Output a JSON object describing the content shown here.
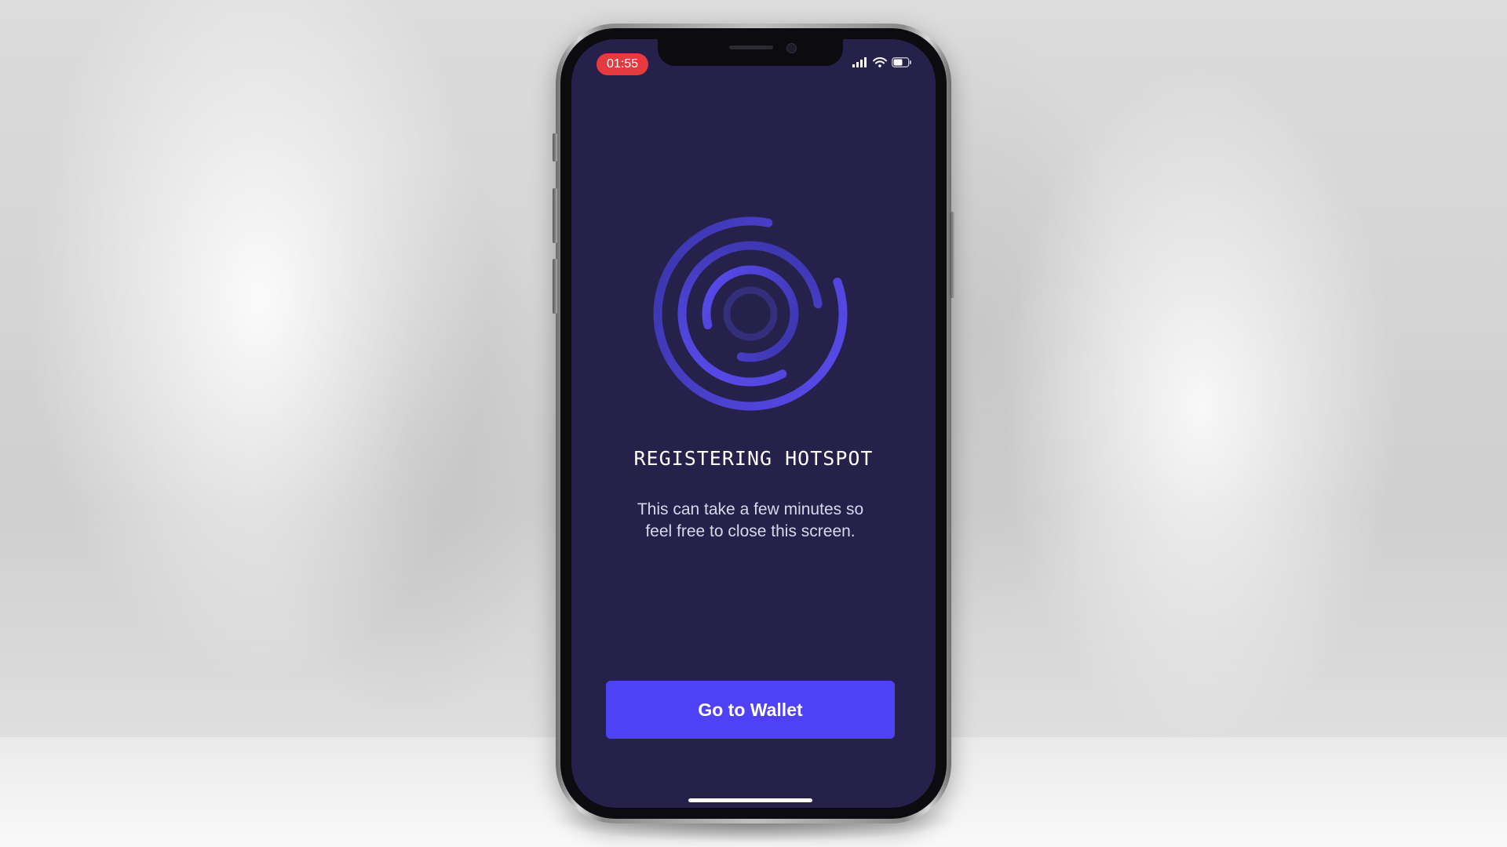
{
  "status_bar": {
    "time": "01:55",
    "icons": [
      "cellular-signal-icon",
      "wifi-icon",
      "battery-icon"
    ]
  },
  "main": {
    "spinner_icon": "loading-rings-icon",
    "title": "REGISTERING HOTSPOT",
    "subtitle": "This can take a few minutes so feel free to close this screen."
  },
  "actions": {
    "primary_label": "Go to Wallet"
  },
  "colors": {
    "screen_background": "#25214a",
    "accent": "#4f41f4",
    "recording_pill": "#e53a3f"
  }
}
